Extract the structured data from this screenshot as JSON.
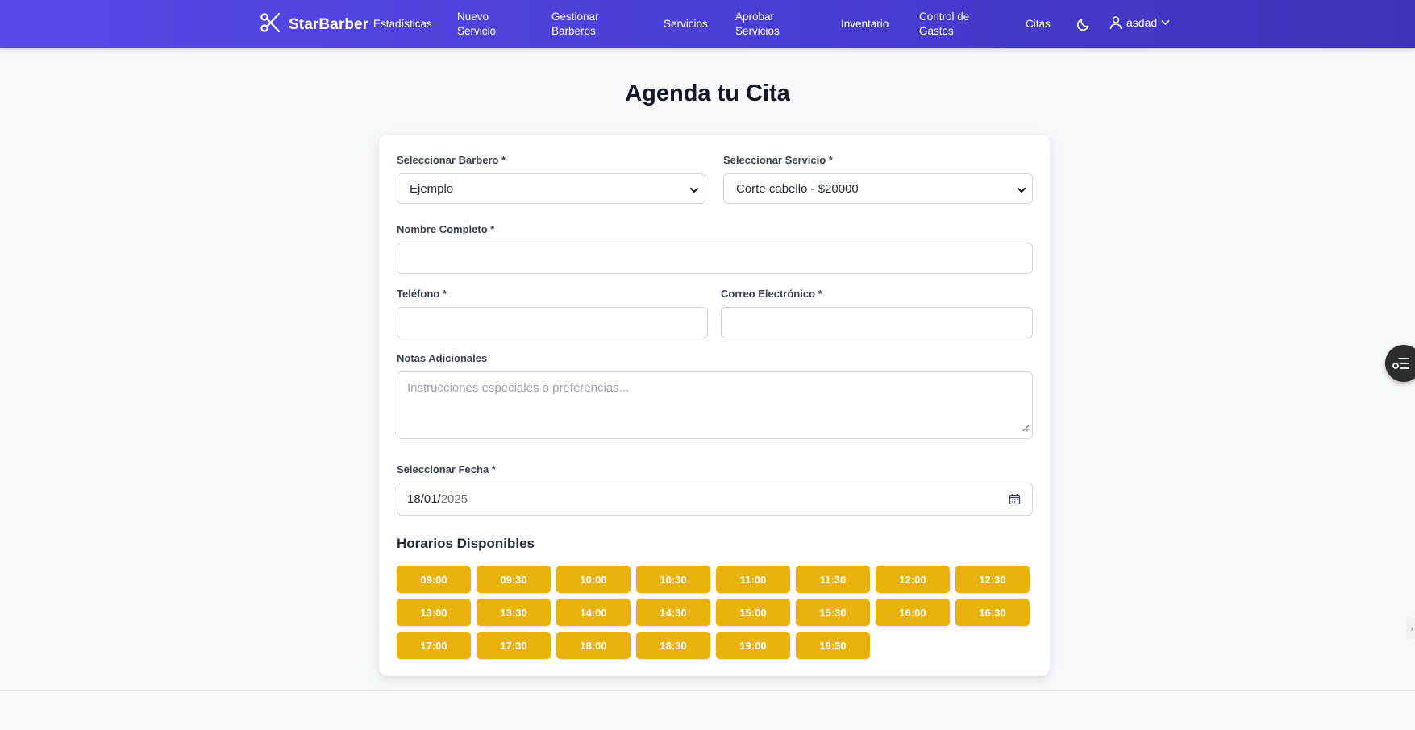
{
  "navbar": {
    "brand": "StarBarber",
    "brand_icon": "scissors-icon",
    "items": [
      {
        "label": "Estadísticas"
      },
      {
        "label": "Nuevo Servicio"
      },
      {
        "label": "Gestionar Barberos"
      },
      {
        "label": "Servicios"
      },
      {
        "label": "Aprobar Servicios"
      },
      {
        "label": "Inventario"
      },
      {
        "label": "Control de Gastos"
      },
      {
        "label": "Citas"
      }
    ],
    "theme_icon": "moon-icon",
    "user": {
      "name": "asdad",
      "icon": "user-icon"
    }
  },
  "page": {
    "title": "Agenda tu Cita"
  },
  "form": {
    "barbero": {
      "label": "Seleccionar Barbero *",
      "value": "Ejemplo"
    },
    "servicio": {
      "label": "Seleccionar Servicio *",
      "value": "Corte cabello - $20000"
    },
    "nombre": {
      "label": "Nombre Completo *",
      "value": ""
    },
    "telefono": {
      "label": "Teléfono *",
      "value": ""
    },
    "correo": {
      "label": "Correo Electrónico *",
      "value": ""
    },
    "notas": {
      "label": "Notas Adicionales",
      "placeholder": "Instrucciones especiales o preferencias..."
    },
    "fecha": {
      "label": "Seleccionar Fecha *",
      "day_month": "18/01/",
      "year": "2025"
    }
  },
  "horarios": {
    "title": "Horarios Disponibles",
    "slots": [
      "09:00",
      "09:30",
      "10:00",
      "10:30",
      "11:00",
      "11:30",
      "12:00",
      "12:30",
      "13:00",
      "13:30",
      "14:00",
      "14:30",
      "15:00",
      "15:30",
      "16:00",
      "16:30",
      "17:00",
      "17:30",
      "18:00",
      "18:30",
      "19:00",
      "19:30"
    ]
  },
  "colors": {
    "navbar_start": "#5749e6",
    "navbar_end": "#3d33b8",
    "slot_button": "#e8b10c",
    "floating_button": "#2b2d31"
  }
}
